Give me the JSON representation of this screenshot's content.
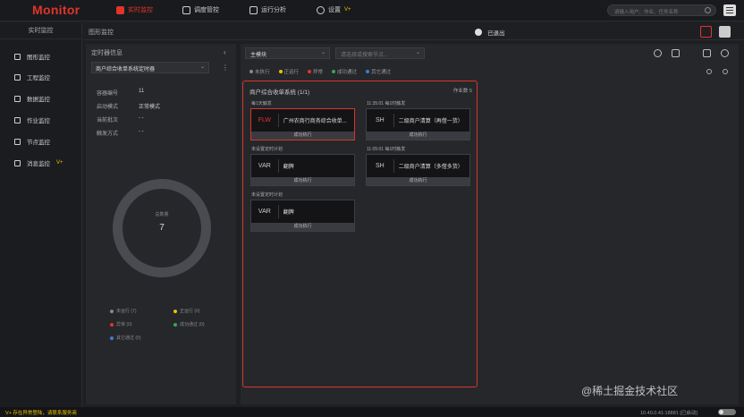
{
  "app": {
    "logo": "Monitor",
    "nav": [
      {
        "label": "实时监控",
        "active": true
      },
      {
        "label": "调度管控"
      },
      {
        "label": "运行分析"
      },
      {
        "label": "设置",
        "badge": "V+"
      }
    ],
    "search_placeholder": "请输入用户、作业、任务名称"
  },
  "sidebar": {
    "title": "实时监控",
    "items": [
      {
        "label": "图形监控"
      },
      {
        "label": "工程监控"
      },
      {
        "label": "数据监控"
      },
      {
        "label": "作业监控"
      },
      {
        "label": "节点监控"
      },
      {
        "label": "消息监控",
        "badge": "V+"
      }
    ]
  },
  "subheader": {
    "title": "图形监控",
    "quit_label": "已退出"
  },
  "left": {
    "title": "定时器信息",
    "collapse": "‹",
    "selected_timer": "商户综合收单系统定时器",
    "more": "⋮",
    "fields": [
      {
        "k": "容器编号",
        "v": "11"
      },
      {
        "k": "启动模式",
        "v": "正常模式"
      },
      {
        "k": "当前批次",
        "v": "- -"
      },
      {
        "k": "触发方式",
        "v": "- -"
      }
    ],
    "donut": {
      "label": "总数量",
      "value": "7"
    },
    "legend": [
      {
        "label": "未运行 (7)",
        "color": "#888888"
      },
      {
        "label": "正运行 (0)",
        "color": "#e8c200"
      },
      {
        "label": "异常 (0)",
        "color": "#e0352b"
      },
      {
        "label": "成功通过 (0)",
        "color": "#3aa655"
      },
      {
        "label": "其它通过 (0)",
        "color": "#3a7fd5"
      }
    ]
  },
  "right": {
    "module_select": "主模块",
    "node_search_placeholder": "请选择或搜索节点...",
    "status": [
      {
        "label": "未执行",
        "color": "#888888"
      },
      {
        "label": "正运行",
        "color": "#e8c200"
      },
      {
        "label": "异常",
        "color": "#e0352b"
      },
      {
        "label": "成功通过",
        "color": "#3aa655"
      },
      {
        "label": "其它通过",
        "color": "#3a7fd5"
      }
    ],
    "flow": {
      "title": "商户综合收单系统 (1/1)",
      "count": "作业数 5",
      "groups": [
        {
          "label": "每1天触发"
        },
        {
          "label": "11:35:01 每1时触发"
        },
        {
          "label": "未设置定时计划"
        },
        {
          "label": "11:05:01 每1时触发"
        },
        {
          "label": "未设置定时计划"
        }
      ],
      "cards": [
        {
          "tag": "FLW",
          "name": "广州农商行商务综合收单...",
          "status": "成功执行"
        },
        {
          "tag": "SH",
          "name": "二级商户清算（再借一货）",
          "status": "成功执行"
        },
        {
          "tag": "VAR",
          "name": "翻牌",
          "status": "成功执行"
        },
        {
          "tag": "SH",
          "name": "二级商户清算（多借多货）",
          "status": "成功执行"
        },
        {
          "tag": "VAR",
          "name": "翻牌",
          "status": "成功执行"
        }
      ]
    }
  },
  "footer": {
    "warning": "V+ 存在异常登陆，请联系服务商",
    "ip": "10.40.0.41:18881",
    "lang": "[已启动]"
  },
  "watermark": "@稀土掘金技术社区",
  "colors": {
    "accent": "#e0352b",
    "bg": "#1e1f23"
  }
}
